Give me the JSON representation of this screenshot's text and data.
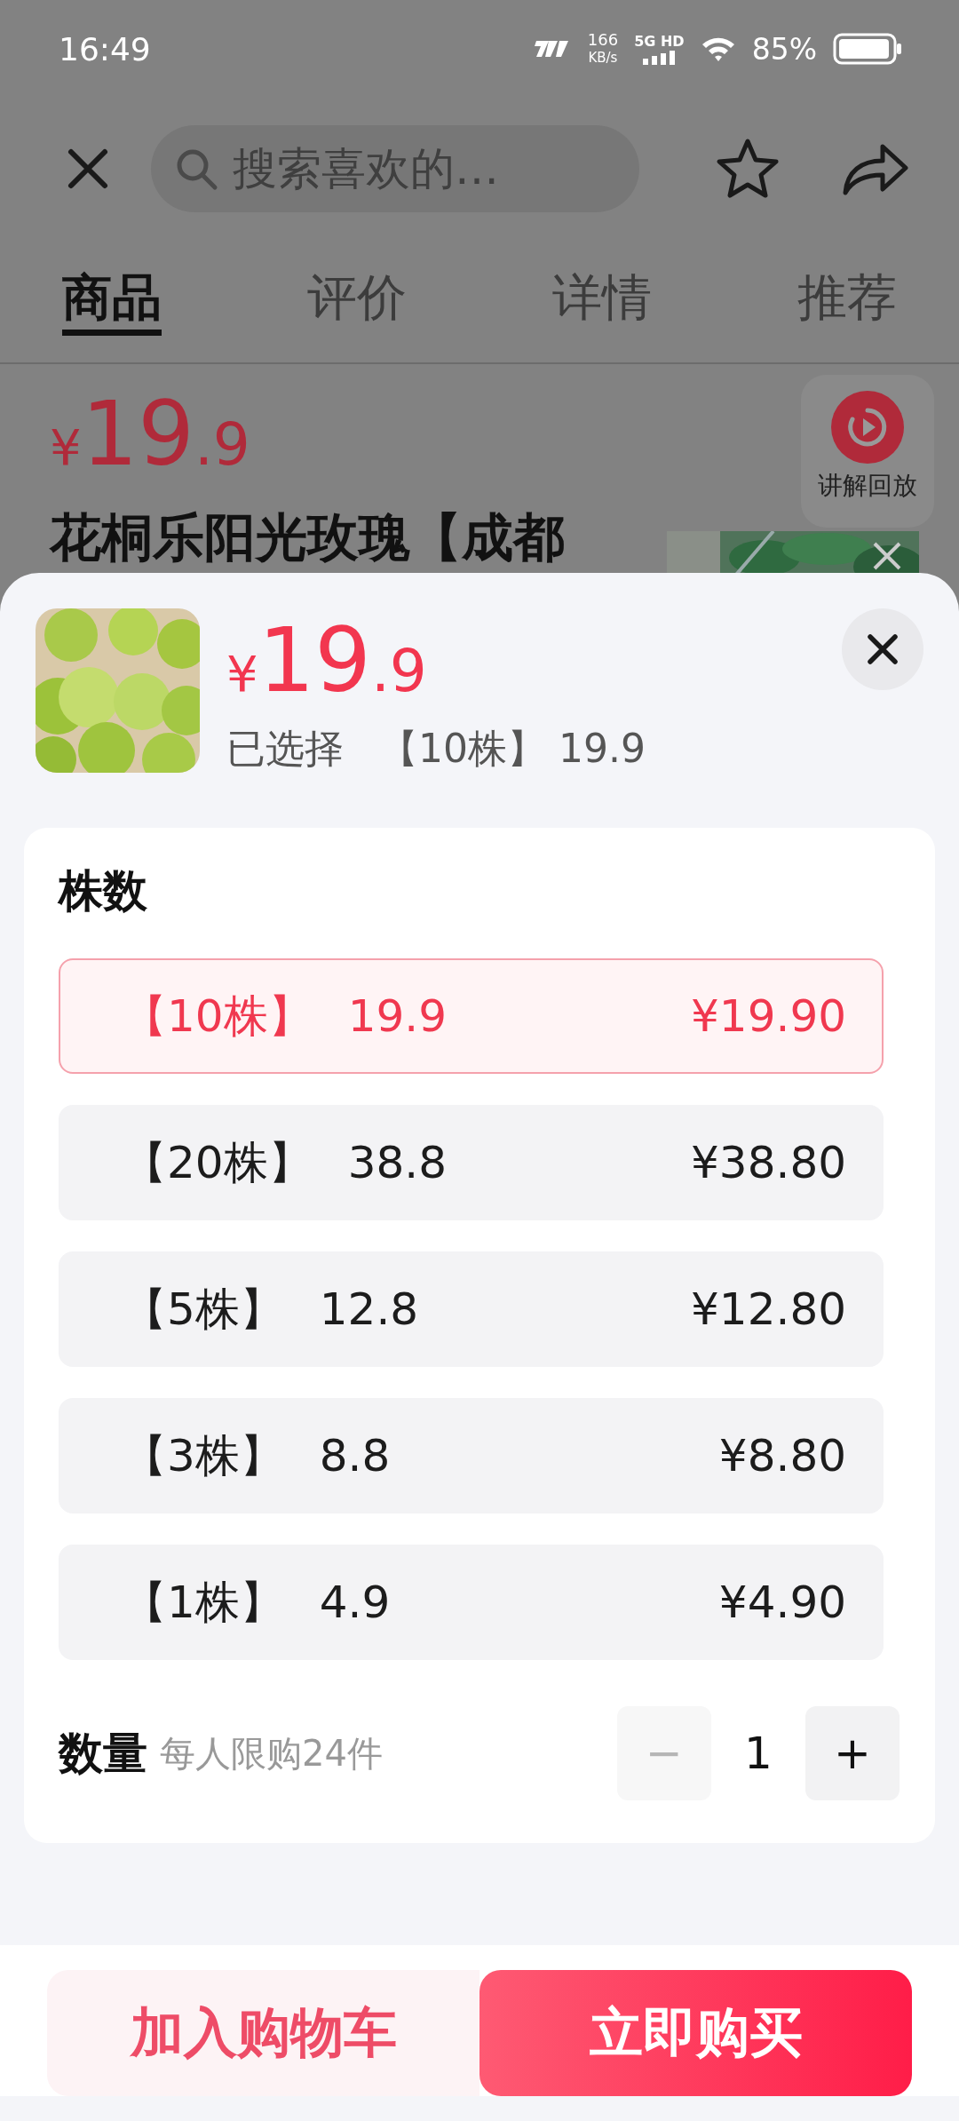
{
  "status_bar": {
    "time": "16:49",
    "net_speed": "166",
    "net_unit": "KB/s",
    "network": "5G HD",
    "battery": "85%"
  },
  "header": {
    "search": {
      "placeholder": "搜索喜欢的…"
    }
  },
  "tabs": [
    {
      "label": "商品",
      "selected": true
    },
    {
      "label": "评价",
      "selected": false
    },
    {
      "label": "详情",
      "selected": false
    },
    {
      "label": "推荐",
      "selected": false
    }
  ],
  "page": {
    "price_symbol": "¥",
    "price_int": "19",
    "price_dec": ".9",
    "title": "花桐乐阳光玫瑰【成都",
    "replay_label": "讲解回放"
  },
  "sheet": {
    "price_symbol": "¥",
    "price_int": "19",
    "price_dec": ".9",
    "selected_label": "已选择",
    "selected_value": "【10株】 19.9",
    "section_title": "株数",
    "options": [
      {
        "label": "【10株】",
        "value": "19.9",
        "price": "¥19.90",
        "selected": true
      },
      {
        "label": "【20株】",
        "value": "38.8",
        "price": "¥38.80",
        "selected": false
      },
      {
        "label": "【5株】",
        "value": "12.8",
        "price": "¥12.80",
        "selected": false
      },
      {
        "label": "【3株】",
        "value": "8.8",
        "price": "¥8.80",
        "selected": false
      },
      {
        "label": "【1株】",
        "value": "4.9",
        "price": "¥4.90",
        "selected": false
      }
    ],
    "quantity": {
      "label": "数量",
      "limit": "每人限购24件",
      "value": "1",
      "minus": "−",
      "plus": "+",
      "minus_disabled": true
    }
  },
  "actions": [
    {
      "label": "加入购物车",
      "kind": "secondary"
    },
    {
      "label": "立即购买",
      "kind": "primary"
    }
  ]
}
